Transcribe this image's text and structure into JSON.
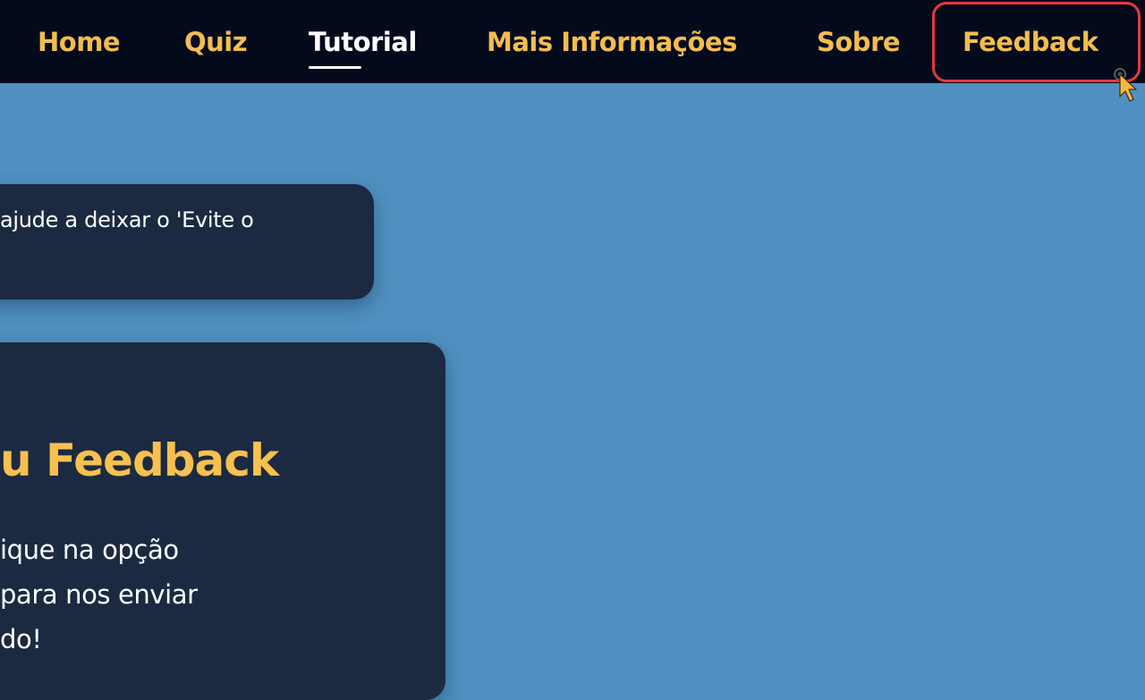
{
  "nav": {
    "home": "Home",
    "quiz": "Quiz",
    "tutorial": "Tutorial",
    "mais_info": "Mais Informações",
    "sobre": "Sobre",
    "feedback": "Feedback",
    "active": "Tutorial"
  },
  "card1": {
    "text": "ajude a deixar o 'Evite o"
  },
  "card2": {
    "title": "u Feedback",
    "lines": [
      "ique na opção",
      "para nos enviar",
      "do!"
    ]
  },
  "colors": {
    "nav_bg": "#030a1c",
    "nav_text": "#f3bd4e",
    "page_bg": "#4f90c0",
    "card_bg": "#1b2a40",
    "highlight": "#e5393d"
  },
  "icons": {
    "cursor": "pointer-cursor-icon"
  }
}
